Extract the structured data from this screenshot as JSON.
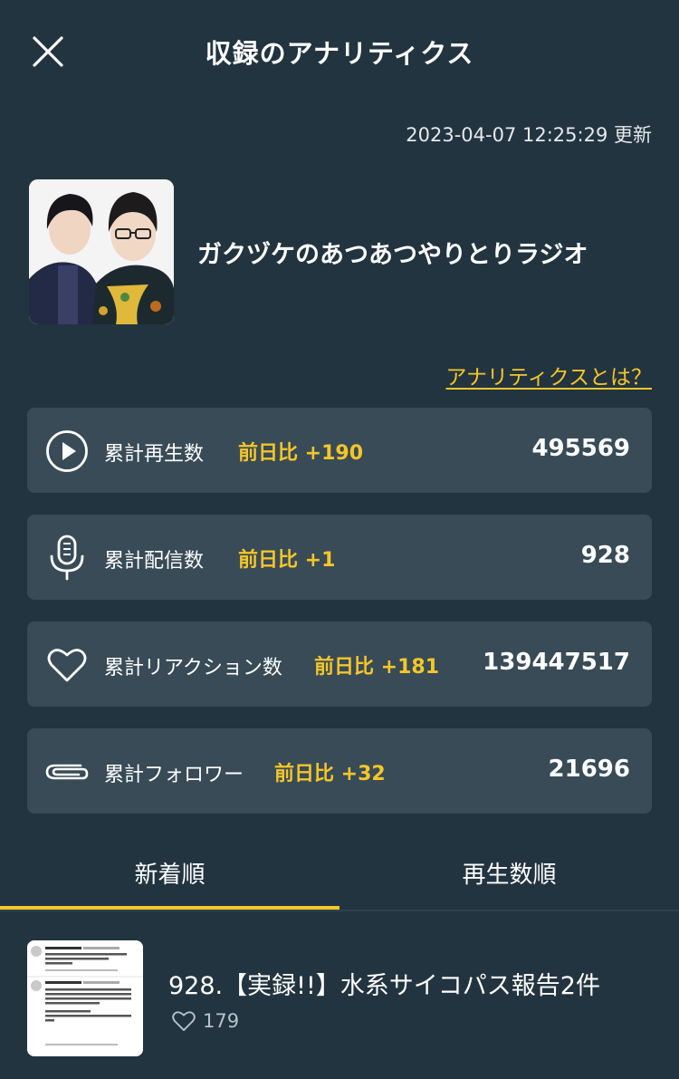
{
  "header": {
    "title": "収録のアナリティクス",
    "close_icon": "close-icon"
  },
  "updated_at": "2023-04-07 12:25:29 更新",
  "channel": {
    "name": "ガクヅケのあつあつやりとりラジオ"
  },
  "about_link": "アナリティクスとは？",
  "stats": [
    {
      "icon": "play-icon",
      "label": "累計再生数",
      "delta": "前日比 +190",
      "value": "495569"
    },
    {
      "icon": "microphone-icon",
      "label": "累計配信数",
      "delta": "前日比 +1",
      "value": "928"
    },
    {
      "icon": "heart-icon",
      "label": "累計リアクション数",
      "delta": "前日比 +181",
      "value": "139447517"
    },
    {
      "icon": "paperclip-icon",
      "label": "累計フォロワー",
      "delta": "前日比 +32",
      "value": "21696"
    }
  ],
  "tabs": [
    {
      "label": "新着順",
      "active": true
    },
    {
      "label": "再生数順",
      "active": false
    }
  ],
  "episodes": [
    {
      "title": "928.【実録!!】水系サイコパス報告2件",
      "likes": "179"
    }
  ],
  "colors": {
    "background": "#223440",
    "card": "#384b57",
    "accent": "#f5c628"
  }
}
